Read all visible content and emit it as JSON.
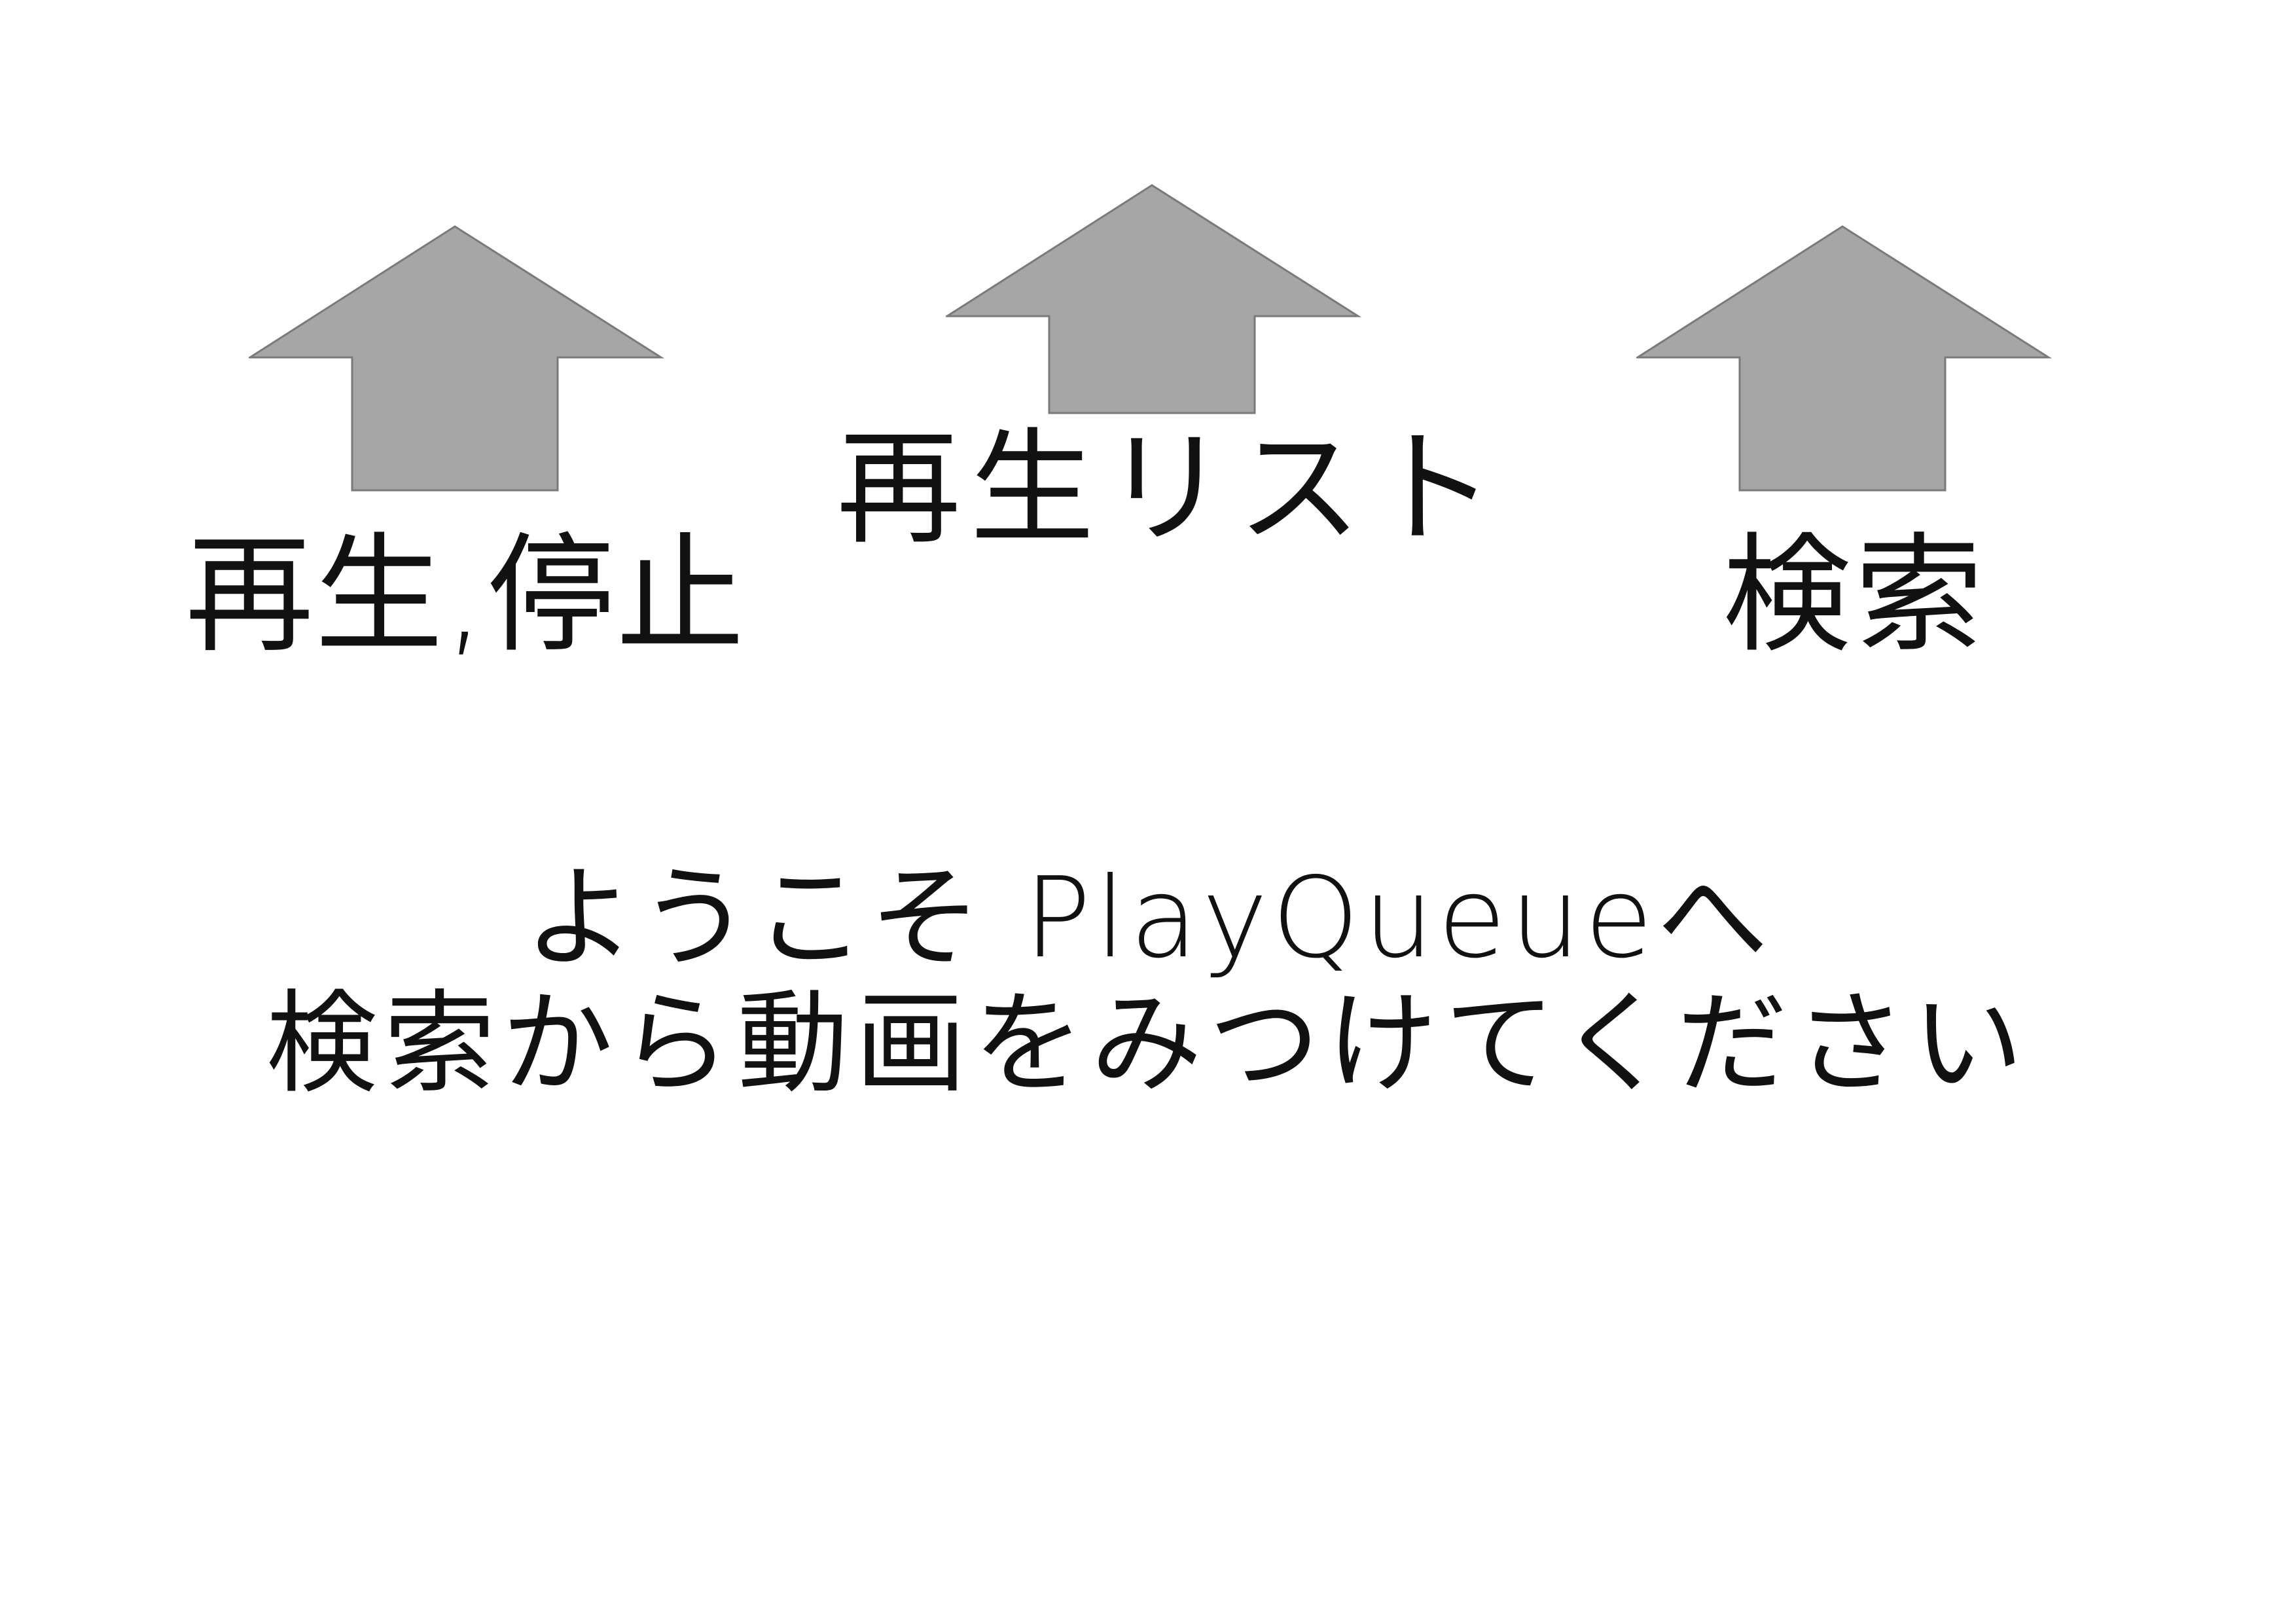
{
  "colors": {
    "arrow_fill": "#a6a6a6",
    "arrow_stroke": "#7a7a7a",
    "background": "#ffffff",
    "text": "#111111"
  },
  "arrows": {
    "play": {
      "icon": "up-arrow-icon",
      "label": "再生,停止"
    },
    "playlist": {
      "icon": "up-arrow-icon",
      "label": "再生リスト"
    },
    "search": {
      "icon": "up-arrow-icon",
      "label": "検索"
    }
  },
  "welcome": {
    "line1": "ようこそ PlayQueueへ",
    "line2": "検索から動画をみつけてください"
  }
}
